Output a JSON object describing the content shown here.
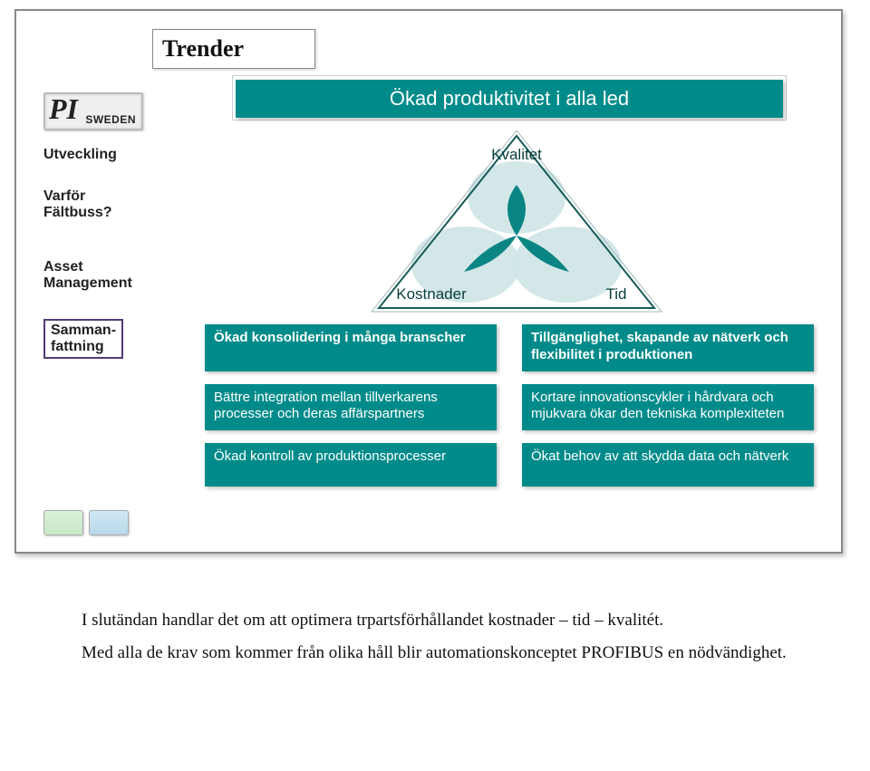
{
  "title": "Trender",
  "logo": {
    "pi": "PI",
    "sweden": "SWEDEN"
  },
  "nav": {
    "item1": "Utveckling",
    "item2a": "Varför",
    "item2b": "Fältbuss?",
    "item3a": "Asset",
    "item3b": "Management",
    "item4a": "Samman-",
    "item4b": "fattning"
  },
  "banner": "Ökad produktivitet i alla led",
  "triangle": {
    "top": "Kvalitet",
    "left": "Kostnader",
    "right": "Tid"
  },
  "boxes": {
    "l1": "Ökad konsolidering i många branscher",
    "r1": "Tillgänglighet, skapande av nätverk och flexibilitet i produktionen",
    "l2": "Bättre integration mellan tillverkarens processer och deras affärspartners",
    "r2": "Kortare innovationscykler i hårdvara och mjukvara ökar den tekniska komplexiteten",
    "l3": "Ökad kontroll av produktions­processer",
    "r3": "Ökat behov av att skydda data och nätverk"
  },
  "below": {
    "p1": "I slutändan handlar det om att optimera trpartsförhållandet kostnader – tid – kvalitét.",
    "p2": "Med alla de krav som kommer från olika håll blir automationskonceptet PROFIBUS en nödvändighet."
  },
  "colors": {
    "teal": "#008b8a"
  }
}
